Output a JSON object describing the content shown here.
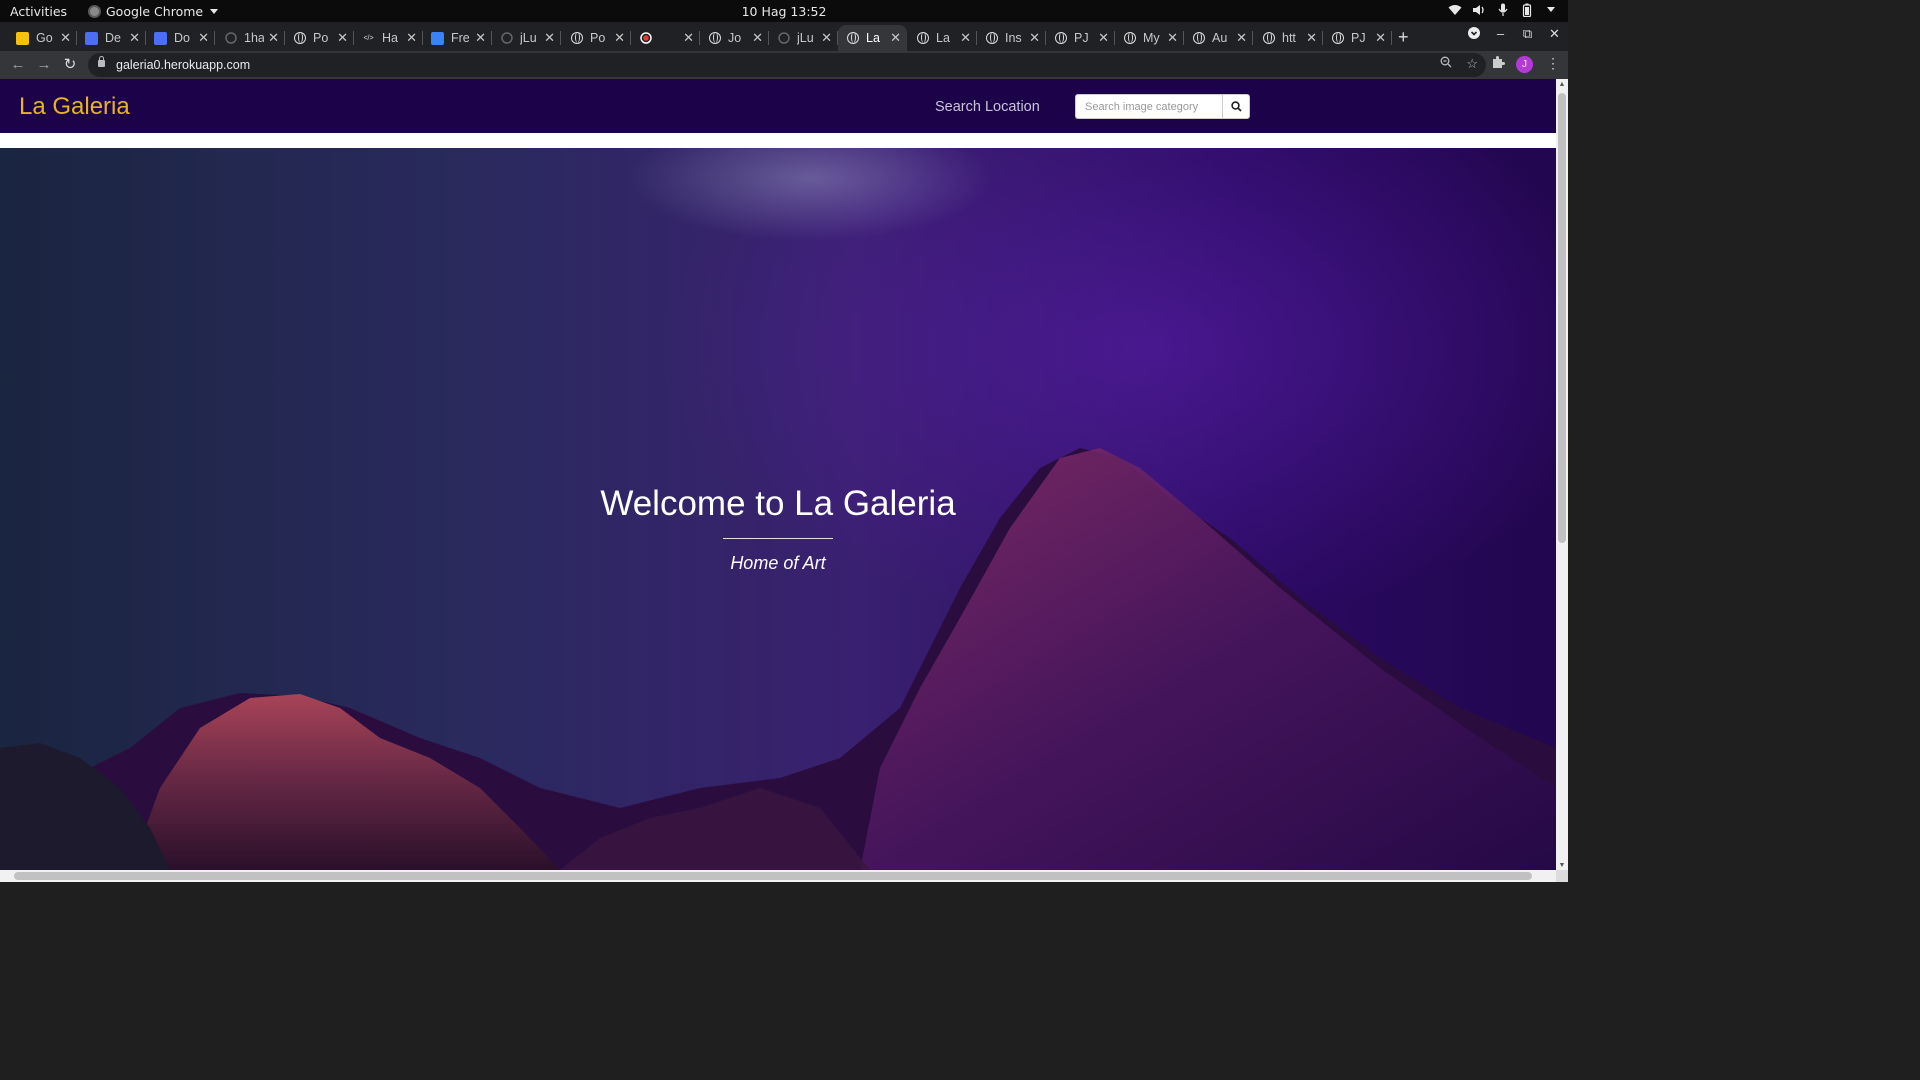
{
  "system_bar": {
    "activities": "Activities",
    "app_name": "Google Chrome",
    "datetime": "10 Hag  13:52",
    "icons": [
      "wifi-icon",
      "volume-icon",
      "mic-icon",
      "battery-icon",
      "system-menu-icon"
    ]
  },
  "tabs": [
    {
      "title": "Go",
      "icon": "keep-icon",
      "color": "#f4c20d",
      "active": false
    },
    {
      "title": "De",
      "icon": "docs-icon",
      "color": "#4c6ef5",
      "active": false
    },
    {
      "title": "Do",
      "icon": "docs-icon",
      "color": "#4c6ef5",
      "active": false
    },
    {
      "title": "1ha",
      "icon": "github-icon",
      "color": "#666666",
      "active": false
    },
    {
      "title": "Po",
      "icon": "globe-icon",
      "color": "#dddddd",
      "active": false
    },
    {
      "title": "Ha",
      "icon": "code-icon",
      "color": "#dddddd",
      "active": false
    },
    {
      "title": "Fre",
      "icon": "app-icon",
      "color": "#3b82f6",
      "active": false
    },
    {
      "title": "jLu",
      "icon": "github-icon",
      "color": "#666666",
      "active": false
    },
    {
      "title": "Po",
      "icon": "globe-icon",
      "color": "#dddddd",
      "active": false
    },
    {
      "title": "",
      "icon": "recording-icon",
      "color": "#e53935",
      "active": false
    },
    {
      "title": "Jo",
      "icon": "globe-icon",
      "color": "#dddddd",
      "active": false
    },
    {
      "title": "jLu",
      "icon": "github-icon",
      "color": "#666666",
      "active": false
    },
    {
      "title": "La",
      "icon": "globe-icon",
      "color": "#dddddd",
      "active": true
    },
    {
      "title": "La",
      "icon": "globe-icon",
      "color": "#dddddd",
      "active": false
    },
    {
      "title": "Ins",
      "icon": "globe-icon",
      "color": "#dddddd",
      "active": false
    },
    {
      "title": "PJ",
      "icon": "globe-icon",
      "color": "#dddddd",
      "active": false
    },
    {
      "title": "My",
      "icon": "globe-icon",
      "color": "#dddddd",
      "active": false
    },
    {
      "title": "Au",
      "icon": "globe-icon",
      "color": "#dddddd",
      "active": false
    },
    {
      "title": "htt",
      "icon": "globe-icon",
      "color": "#dddddd",
      "active": false
    },
    {
      "title": "PJ",
      "icon": "globe-icon",
      "color": "#dddddd",
      "active": false
    }
  ],
  "browser": {
    "url": "galeria0.herokuapp.com",
    "new_tab": "+",
    "avatar_initial": "J"
  },
  "page": {
    "brand": "La Galeria",
    "brand_color": "#e6b422",
    "navbar_color": "#1c0349",
    "nav_link": "Search Location",
    "search_placeholder": "Search image category",
    "hero_title": "Welcome to La Galeria",
    "hero_subtitle": "Home of Art"
  }
}
